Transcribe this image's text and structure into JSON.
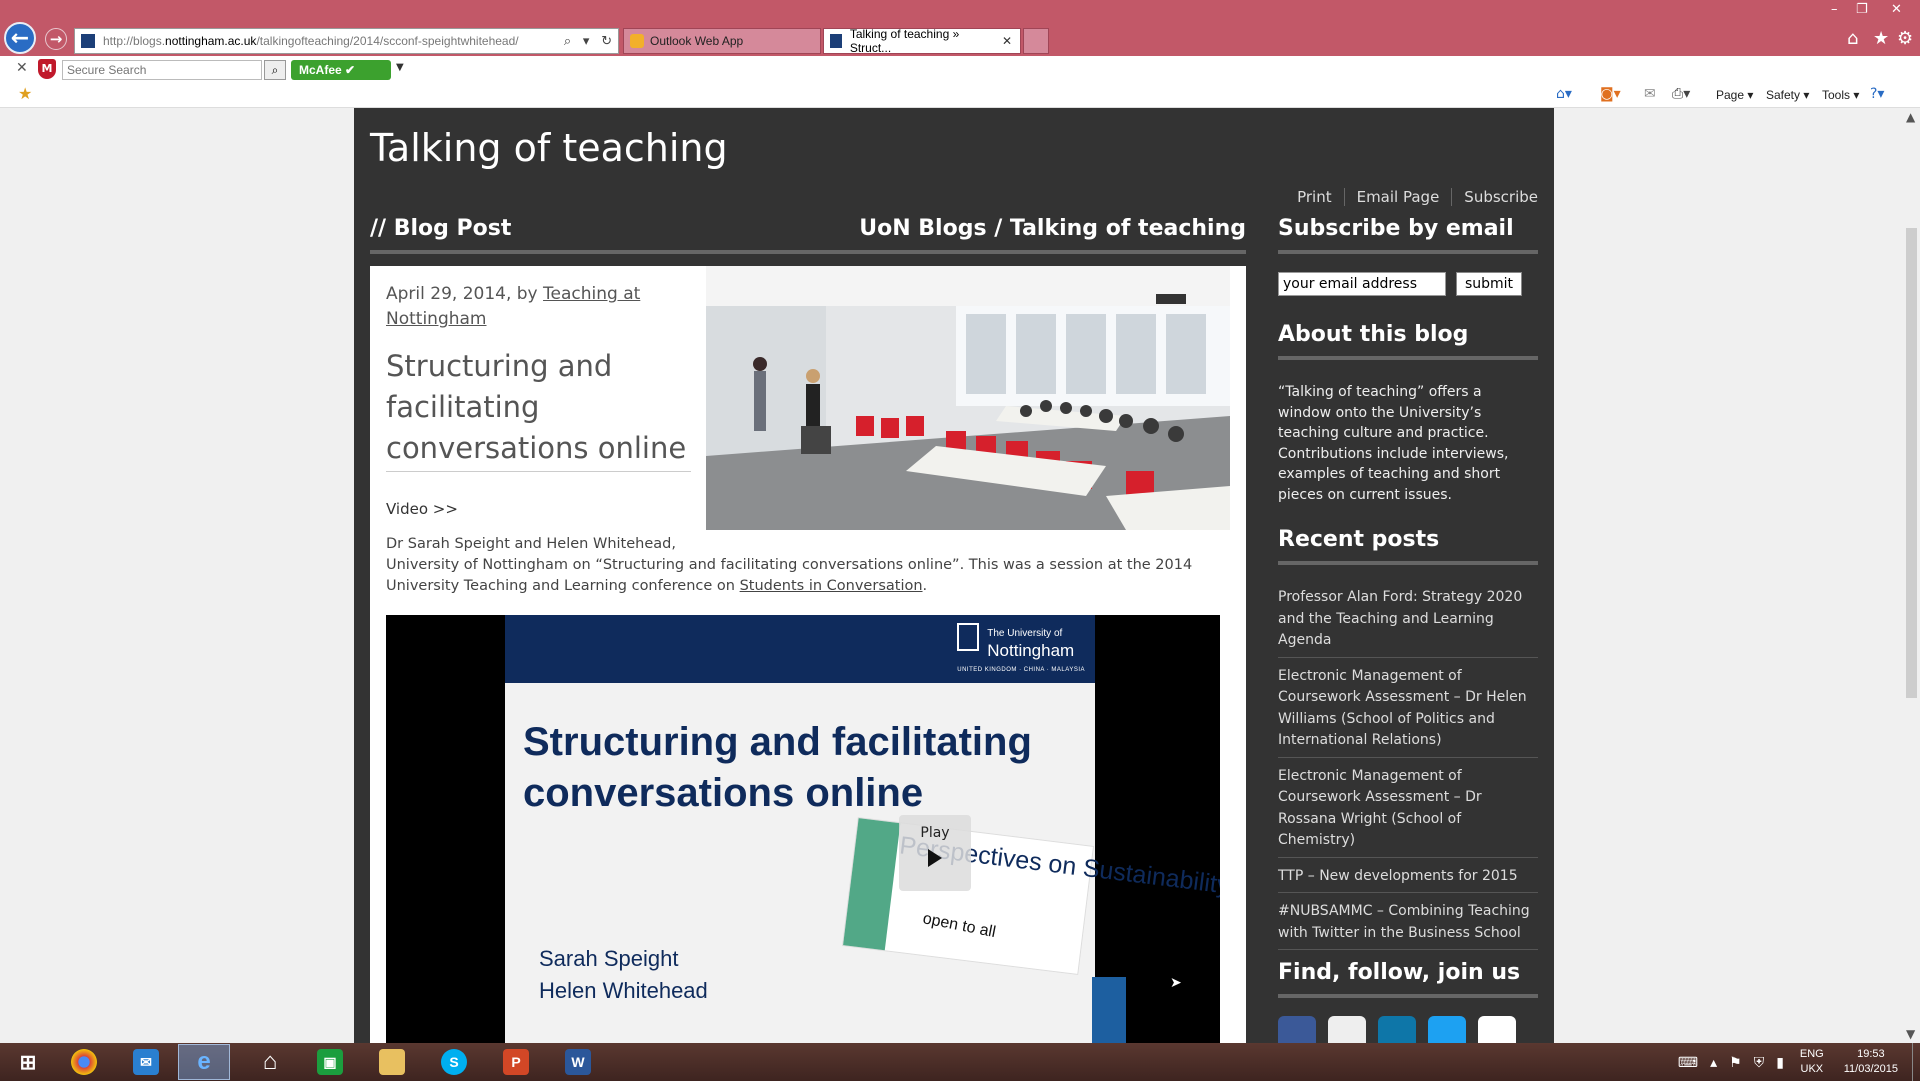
{
  "browser": {
    "url_prefix": "http://blogs.",
    "url_domain": "nottingham.ac.uk",
    "url_path": "/talkingofteaching/2014/scconf-speightwhitehead/",
    "tabs": [
      {
        "label": "Outlook Web App"
      },
      {
        "label": "Talking of teaching » Struct..."
      }
    ],
    "search_placeholder": "Secure Search",
    "mcafee_label": "McAfee",
    "commands": {
      "page": "Page",
      "safety": "Safety",
      "tools": "Tools"
    }
  },
  "site": {
    "title": "Talking of teaching",
    "top_links": [
      "Print",
      "Email Page",
      "Subscribe"
    ],
    "section_label": "// Blog Post",
    "breadcrumb": "UoN Blogs / Talking of teaching"
  },
  "post": {
    "date_by": "April 29, 2014, by ",
    "author": "Teaching at Nottingham",
    "title": "Structuring and facilitating conversations online",
    "video_link": "Video >>",
    "body_line1": "Dr Sarah Speight and Helen Whitehead,",
    "body_line2": "University of Nottingham on “Structuring and facilitating conversations online”. This was a session at the 2014 University Teaching and Learning conference on ",
    "body_link": "Students in Conversation",
    "body_end": "."
  },
  "video": {
    "logo_top": "The University of",
    "logo_name": "Nottingham",
    "logo_sub": "UNITED KINGDOM · CHINA · MALAYSIA",
    "slide_title": "Structuring and facilitating conversations online",
    "author1": "Sarah Speight",
    "author2": "Helen Whitehead",
    "play_label": "Play",
    "banner_line1": "Perspectives on Sustainability",
    "banner_line2": "open to all"
  },
  "sidebar": {
    "subscribe_heading": "Subscribe by email",
    "email_value": "your email address",
    "submit_label": "submit",
    "about_heading": "About this blog",
    "about_text": "“Talking of teaching” offers a window onto the University’s teaching culture and practice. Contributions include interviews, examples of teaching and short pieces on current issues.",
    "recent_heading": "Recent posts",
    "recent_posts": [
      "Professor Alan Ford: Strategy 2020 and the Teaching and Learning Agenda",
      "Electronic Management of Coursework Assessment – Dr Helen Williams (School of Politics and International Relations)",
      "Electronic Management of Coursework Assessment – Dr Rossana Wright (School of Chemistry)",
      "TTP – New developments for 2015",
      "#NUBSAMMC – Combining Teaching with Twitter in the Business School"
    ],
    "follow_heading": "Find, follow, join us"
  },
  "taskbar": {
    "language": "ENG",
    "layout": "UKX",
    "time": "19:53",
    "date": "11/03/2015"
  },
  "colors": {
    "site_bg": "#333333",
    "chrome_accent": "#c25868",
    "uon_navy": "#0f2b5c"
  }
}
